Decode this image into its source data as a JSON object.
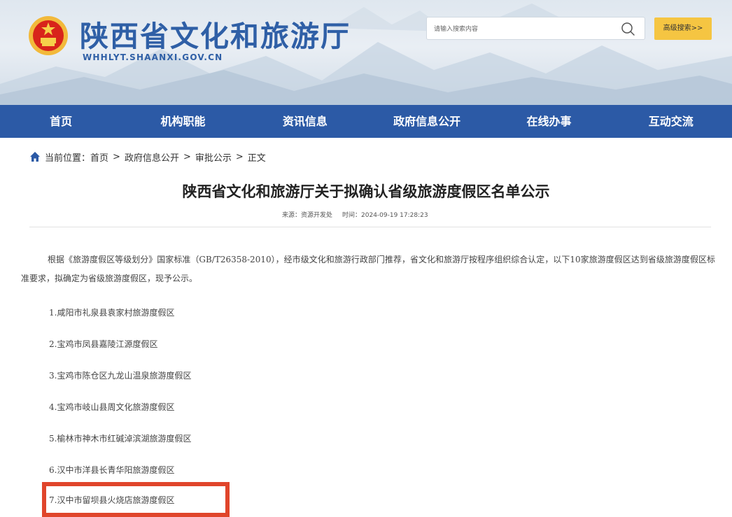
{
  "header": {
    "site_title": "陕西省文化和旅游厅",
    "site_domain": "WHHLYT.SHAANXI.GOV.CN",
    "search_placeholder": "请输入搜索内容",
    "advanced_search": "高级搜索>>",
    "emblem_icon": "national-emblem-icon",
    "search_icon": "search-icon"
  },
  "nav": {
    "items": [
      "首页",
      "机构职能",
      "资讯信息",
      "政府信息公开",
      "在线办事",
      "互动交流"
    ]
  },
  "breadcrumb": {
    "label": "当前位置：",
    "items": [
      "首页",
      "政府信息公开",
      "审批公示",
      "正文"
    ],
    "separator": ">"
  },
  "article": {
    "title": "陕西省文化和旅游厅关于拟确认省级旅游度假区名单公示",
    "source_label": "来源：资源开发处",
    "time_label": "时间：2024-09-19 17:28:23",
    "intro": "根据《旅游度假区等级划分》国家标准（GB/T26358-2010），经市级文化和旅游行政部门推荐，省文化和旅游厅按程序组织综合认定，以下10家旅游度假区达到省级旅游度假区标准要求，拟确定为省级旅游度假区，现予公示。",
    "list": [
      "1.咸阳市礼泉县袁家村旅游度假区",
      "2.宝鸡市凤县嘉陵江源度假区",
      "3.宝鸡市陈仓区九龙山温泉旅游度假区",
      "4.宝鸡市岐山县周文化旅游度假区",
      "5.榆林市神木市红碱淖滨湖旅游度假区",
      "6.汉中市洋县长青华阳旅游度假区",
      "7.汉中市留坝县火烧店旅游度假区"
    ]
  },
  "colors": {
    "nav_bg": "#2c5aa6",
    "title_blue": "#2f5fa6",
    "highlight_red": "#e0452b",
    "adv_search_bg": "#f5c542"
  }
}
